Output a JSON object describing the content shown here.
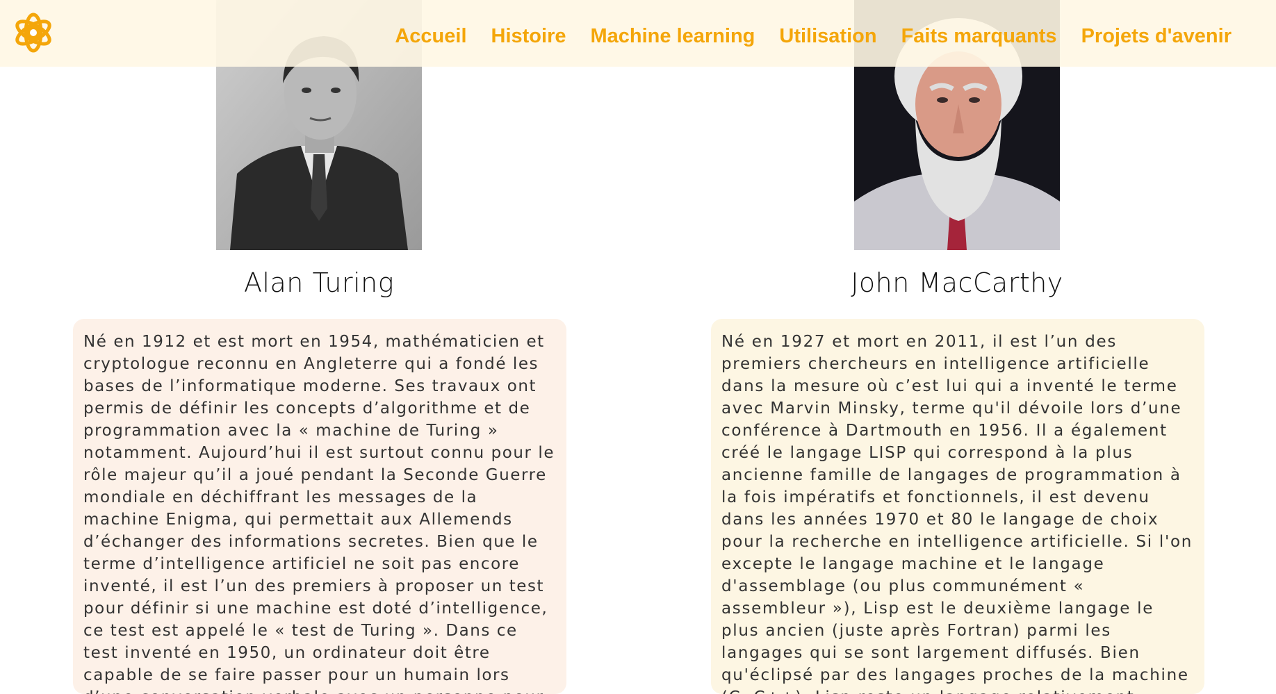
{
  "nav": {
    "items": [
      {
        "label": "Accueil"
      },
      {
        "label": "Histoire"
      },
      {
        "label": "Machine learning"
      },
      {
        "label": "Utilisation"
      },
      {
        "label": "Faits marquants"
      },
      {
        "label": "Projets d'avenir"
      }
    ],
    "logo_icon": "atom-icon",
    "accent_color": "#f4a60a"
  },
  "people": [
    {
      "name": "Alan Turing",
      "bio": "Né en 1912 et est mort en 1954, mathématicien et cryptologue reconnu en Angleterre qui a fondé les bases de l’informatique moderne. Ses travaux ont permis de définir les concepts d’algorithme et de programmation avec la « machine de Turing » notamment. Aujourd’hui il est surtout connu pour le rôle majeur qu’il a joué pendant la Seconde Guerre mondiale en déchiffrant les messages de la machine Enigma, qui permettait aux Allemends d’échanger des informations secretes. Bien que le terme d’intelligence artificiel ne soit pas encore inventé, il est l’un des premiers à proposer un test pour définir si une machine est doté d’intelligence, ce test est appelé le « test de Turing ». Dans ce test inventé en 1950, un ordinateur doit être capable de se faire passer pour un humain lors d’une conversation verbale avec un personne pour être qualifier d’intelligente."
    },
    {
      "name": "John MacCarthy",
      "bio": "Né en 1927 et mort en 2011, il est l’un des premiers chercheurs en intelligence artificielle dans la mesure où c’est lui qui a inventé le terme avec Marvin Minsky, terme qu'il dévoile lors d’une conférence à Dartmouth en 1956. Il a également créé le langage LISP qui correspond à la plus ancienne famille de langages de programmation à la fois impératifs et fonctionnels, il est devenu dans les années 1970 et 80 le langage de choix pour la recherche en intelligence artificielle. Si l'on excepte le langage machine et le langage d'assemblage (ou plus communément « assembleur »), Lisp est le deuxième langage le plus ancien (juste après Fortran) parmi les langages qui se sont largement diffusés. Bien qu'éclipsé par des langages proches de la machine (C, C++), Lisp reste un langage relativement utilisé, en particulier en tant que langage embarqué dans des applications."
    }
  ]
}
